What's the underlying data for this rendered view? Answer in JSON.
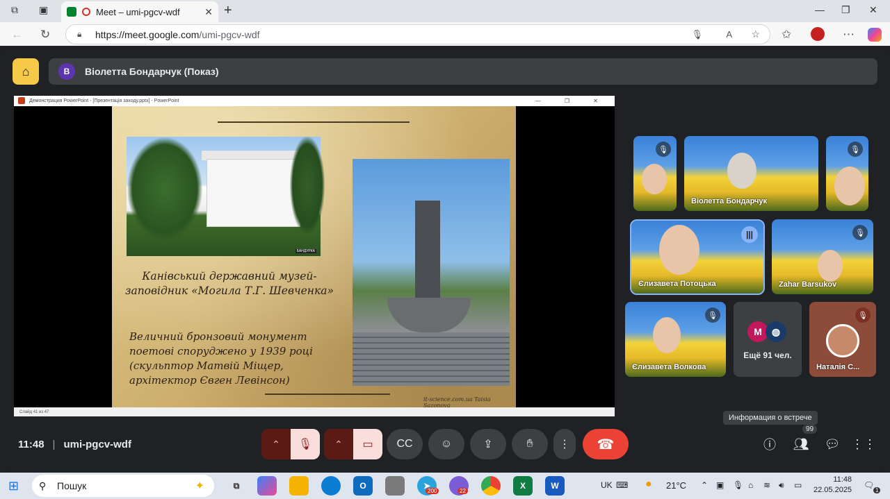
{
  "browser": {
    "tab_title": "Meet – umi-pgcv-wdf",
    "url_host": "https://meet.google.com",
    "url_path": "/umi-pgcv-wdf"
  },
  "meet": {
    "presenter_initial": "В",
    "presenter_label": "Віолетта Бондарчук (Показ)",
    "time": "11:48",
    "meeting_code": "umi-pgcv-wdf",
    "tooltip": "Информация о встрече",
    "people_count": "99"
  },
  "presentation": {
    "window_title": "Демонстрация PowerPoint - [Презентація заходу.pptx] - PowerPoint",
    "slide_heading": "Канівський державний музей-заповідник «Могила Т.Г. Шевченка»",
    "slide_body": "Величний бронзовий монумент поетові споруджено у 1939 році (скульптор Матвій Міщер, архітектор Євген Левінсон)",
    "slide_credit": "it-science.com.ua Taisia Sazonova",
    "photo_caption": "БАНДУРКА",
    "status": "Слайд 41 из 47"
  },
  "participants": [
    {
      "name": "",
      "muted": true
    },
    {
      "name": "Віолетта Бондарчук",
      "muted": false
    },
    {
      "name": "",
      "muted": true
    },
    {
      "name": "Єлизавета Потоцька",
      "speaking": true
    },
    {
      "name": "Zahar Barsukov",
      "muted": true
    },
    {
      "name": "Єлизавета Волкова",
      "muted": true
    },
    {
      "name": "Ещё 91 чел.",
      "avatar_letter": "M"
    },
    {
      "name": "Наталія С...",
      "muted": true
    }
  ],
  "taskbar": {
    "search": "Пошук",
    "lang": "UK",
    "weather": "21°C",
    "clock_time": "11:48",
    "clock_date": "22.05.2025",
    "badge_telegram": "200",
    "badge_viber": "22",
    "notif": "1"
  },
  "colors": {
    "meet_bg": "#202124",
    "end_call": "#ea4335",
    "muted_btn": "#f9dedc",
    "home_btn": "#f7c948"
  }
}
